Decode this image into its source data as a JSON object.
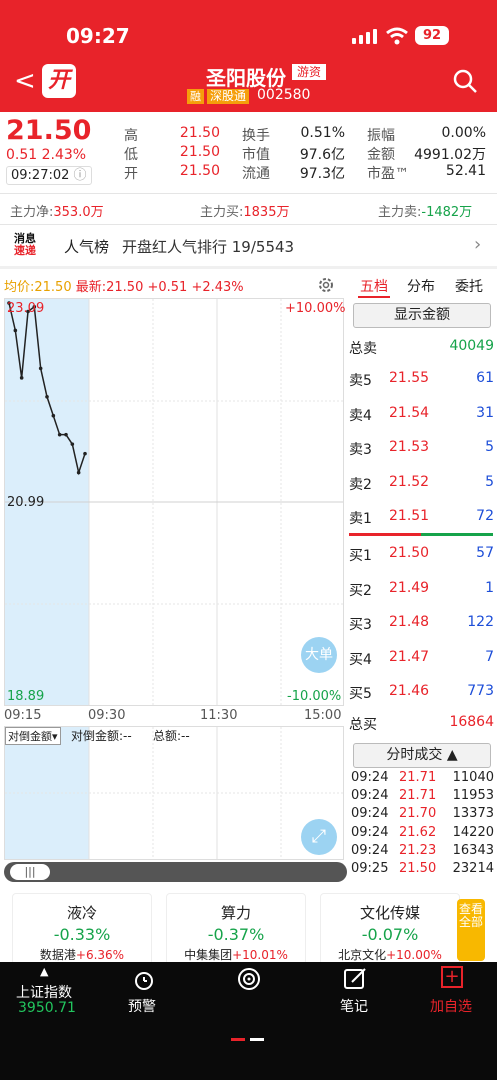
{
  "status": {
    "time": "09:27",
    "battery": "92"
  },
  "header": {
    "kai": "开",
    "name": "圣阳股份",
    "tag": "游资",
    "rong": "融",
    "sgt": "深股通",
    "code": "002580"
  },
  "quote": {
    "price": "21.50",
    "change": "0.51 2.43%",
    "time": "09:27:02",
    "fields": [
      {
        "l1": "高",
        "v1": "21.50",
        "l2": "换手",
        "v2": "0.51%",
        "l3": "振幅",
        "v3": "0.00%"
      },
      {
        "l1": "低",
        "v1": "21.50",
        "l2": "市值",
        "v2": "97.6亿",
        "l3": "金额",
        "v3": "4991.02万"
      },
      {
        "l1": "开",
        "v1": "21.50",
        "l2": "流通",
        "v2": "97.3亿",
        "l3": "市盈™",
        "v3": "52.41"
      }
    ]
  },
  "flow": {
    "net_label": "主力净:",
    "net": "353.0万",
    "buy_label": "主力买:",
    "buy": "1835万",
    "sell_label": "主力卖:",
    "sell": "-1482万"
  },
  "news": {
    "logo1": "消息",
    "logo2": "速递",
    "label": "人气榜",
    "text": "开盘红人气排行 19/5543"
  },
  "chart": {
    "avg": "均价:21.50",
    "latest": "最新:21.50 +0.51 +2.43%",
    "high": "23.09",
    "mid": "20.99",
    "low": "18.89",
    "pct_up": "+10.00%",
    "pct_down": "-10.00%",
    "times": [
      "09:15",
      "09:30",
      "11:30",
      "15:00"
    ],
    "dadan": "大单",
    "vol_selector": "对倒金额",
    "vol_a": "对倒金额:--",
    "vol_b": "总额:--"
  },
  "chart_data": {
    "type": "line",
    "x": [
      "09:15",
      "09:16",
      "09:17",
      "09:18",
      "09:19",
      "09:20",
      "09:21",
      "09:22",
      "09:23",
      "09:24",
      "09:25",
      "09:26",
      "09:27"
    ],
    "values": [
      23.09,
      22.8,
      22.3,
      23.0,
      23.05,
      22.4,
      22.1,
      21.9,
      21.7,
      21.7,
      21.6,
      21.3,
      21.5
    ],
    "ylim": [
      18.89,
      23.09
    ]
  },
  "tabs": [
    "五档",
    "分布",
    "委托"
  ],
  "orderbook": {
    "show_amount": "显示金额",
    "total_sell_label": "总卖",
    "total_sell": "40049",
    "total_buy_label": "总买",
    "total_buy": "16864",
    "asks": [
      {
        "l": "卖5",
        "p": "21.55",
        "v": "61"
      },
      {
        "l": "卖4",
        "p": "21.54",
        "v": "31"
      },
      {
        "l": "卖3",
        "p": "21.53",
        "v": "5"
      },
      {
        "l": "卖2",
        "p": "21.52",
        "v": "5"
      },
      {
        "l": "卖1",
        "p": "21.51",
        "v": "72"
      }
    ],
    "bids": [
      {
        "l": "买1",
        "p": "21.50",
        "v": "57"
      },
      {
        "l": "买2",
        "p": "21.49",
        "v": "1"
      },
      {
        "l": "买3",
        "p": "21.48",
        "v": "122"
      },
      {
        "l": "买4",
        "p": "21.47",
        "v": "7"
      },
      {
        "l": "买5",
        "p": "21.46",
        "v": "773"
      }
    ]
  },
  "ticks": {
    "button": "分时成交 ▲",
    "rows": [
      {
        "t": "09:24",
        "p": "21.71",
        "v": "11040"
      },
      {
        "t": "09:24",
        "p": "21.71",
        "v": "11953"
      },
      {
        "t": "09:24",
        "p": "21.70",
        "v": "13373"
      },
      {
        "t": "09:24",
        "p": "21.62",
        "v": "14220"
      },
      {
        "t": "09:24",
        "p": "21.23",
        "v": "16343"
      },
      {
        "t": "09:25",
        "p": "21.50",
        "v": "23214"
      }
    ]
  },
  "sectors": [
    {
      "name": "液冷",
      "pct": "-0.33%",
      "stock": "数据港",
      "spct": "+6.36%"
    },
    {
      "name": "算力",
      "pct": "-0.37%",
      "stock": "中集集团",
      "spct": "+10.01%"
    },
    {
      "name": "文化传媒",
      "pct": "-0.07%",
      "stock": "北京文化",
      "spct": "+10.00%"
    }
  ],
  "view_all": "查看全部",
  "nav": {
    "index_name": "上证指数",
    "index_value": "3950.71",
    "alert": "预警",
    "note": "笔记",
    "add": "加自选"
  }
}
